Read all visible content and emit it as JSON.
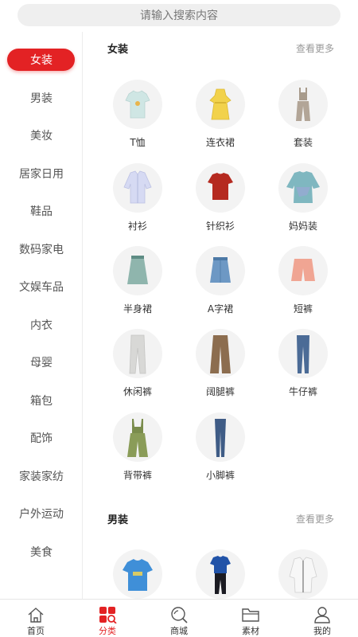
{
  "search": {
    "placeholder": "请输入搜索内容"
  },
  "sidebar": {
    "items": [
      {
        "label": "女装",
        "active": true
      },
      {
        "label": "男装"
      },
      {
        "label": "美妆"
      },
      {
        "label": "居家日用"
      },
      {
        "label": "鞋品"
      },
      {
        "label": "数码家电"
      },
      {
        "label": "文娱车品"
      },
      {
        "label": "内衣"
      },
      {
        "label": "母婴"
      },
      {
        "label": "箱包"
      },
      {
        "label": "配饰"
      },
      {
        "label": "家装家纺"
      },
      {
        "label": "户外运动"
      },
      {
        "label": "美食"
      }
    ]
  },
  "sections": [
    {
      "title": "女装",
      "more": "查看更多",
      "items": [
        {
          "label": "T恤",
          "icon": "tshirt-icon"
        },
        {
          "label": "连衣裙",
          "icon": "dress-icon"
        },
        {
          "label": "套装",
          "icon": "suit-set-icon"
        },
        {
          "label": "衬衫",
          "icon": "shirt-icon"
        },
        {
          "label": "针织衫",
          "icon": "knit-sweater-icon"
        },
        {
          "label": "妈妈装",
          "icon": "mom-wear-icon"
        },
        {
          "label": "半身裙",
          "icon": "skirt-icon"
        },
        {
          "label": "A字裙",
          "icon": "a-line-skirt-icon"
        },
        {
          "label": "短裤",
          "icon": "shorts-icon"
        },
        {
          "label": "休闲裤",
          "icon": "casual-pants-icon"
        },
        {
          "label": "阔腿裤",
          "icon": "wide-leg-pants-icon"
        },
        {
          "label": "牛仔裤",
          "icon": "jeans-icon"
        },
        {
          "label": "背带裤",
          "icon": "overalls-icon"
        },
        {
          "label": "小脚裤",
          "icon": "skinny-pants-icon"
        }
      ]
    },
    {
      "title": "男装",
      "more": "查看更多",
      "items": [
        {
          "label": "",
          "icon": "mens-tshirt-icon"
        },
        {
          "label": "",
          "icon": "mens-outfit-icon"
        },
        {
          "label": "",
          "icon": "mens-jacket-icon"
        }
      ]
    }
  ],
  "tabbar": {
    "items": [
      {
        "label": "首页",
        "icon": "home-icon"
      },
      {
        "label": "分类",
        "icon": "category-icon",
        "active": true
      },
      {
        "label": "商城",
        "icon": "mall-search-icon"
      },
      {
        "label": "素材",
        "icon": "folder-icon"
      },
      {
        "label": "我的",
        "icon": "user-icon"
      }
    ]
  },
  "colors": {
    "accent": "#e32224",
    "placeholder_bg": "#efefef",
    "circle_bg": "#f3f3f3"
  }
}
